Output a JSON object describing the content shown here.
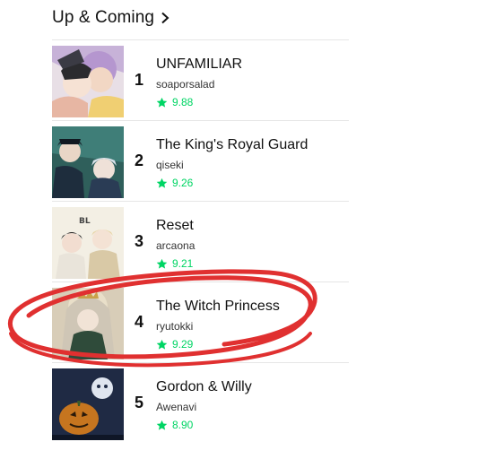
{
  "header": {
    "title": "Up & Coming"
  },
  "items": [
    {
      "rank": "1",
      "title": "UNFAMILIAR",
      "author": "soaporsalad",
      "rating": "9.88"
    },
    {
      "rank": "2",
      "title": "The King's Royal Guard",
      "author": "qiseki",
      "rating": "9.26"
    },
    {
      "rank": "3",
      "title": "Reset",
      "author": "arcaona",
      "rating": "9.21"
    },
    {
      "rank": "4",
      "title": "The Witch Princess",
      "author": "ryutokki",
      "rating": "9.29"
    },
    {
      "rank": "5",
      "title": "Gordon & Willy",
      "author": "Awenavi",
      "rating": "8.90"
    }
  ],
  "thumbnail_3": {
    "badge": "BL"
  },
  "colors": {
    "rating_green": "#00d564",
    "annotation_red": "#e03030",
    "divider": "#e6e6e6"
  },
  "icons": {
    "header": "chevron-right-icon",
    "rating": "star-icon"
  }
}
